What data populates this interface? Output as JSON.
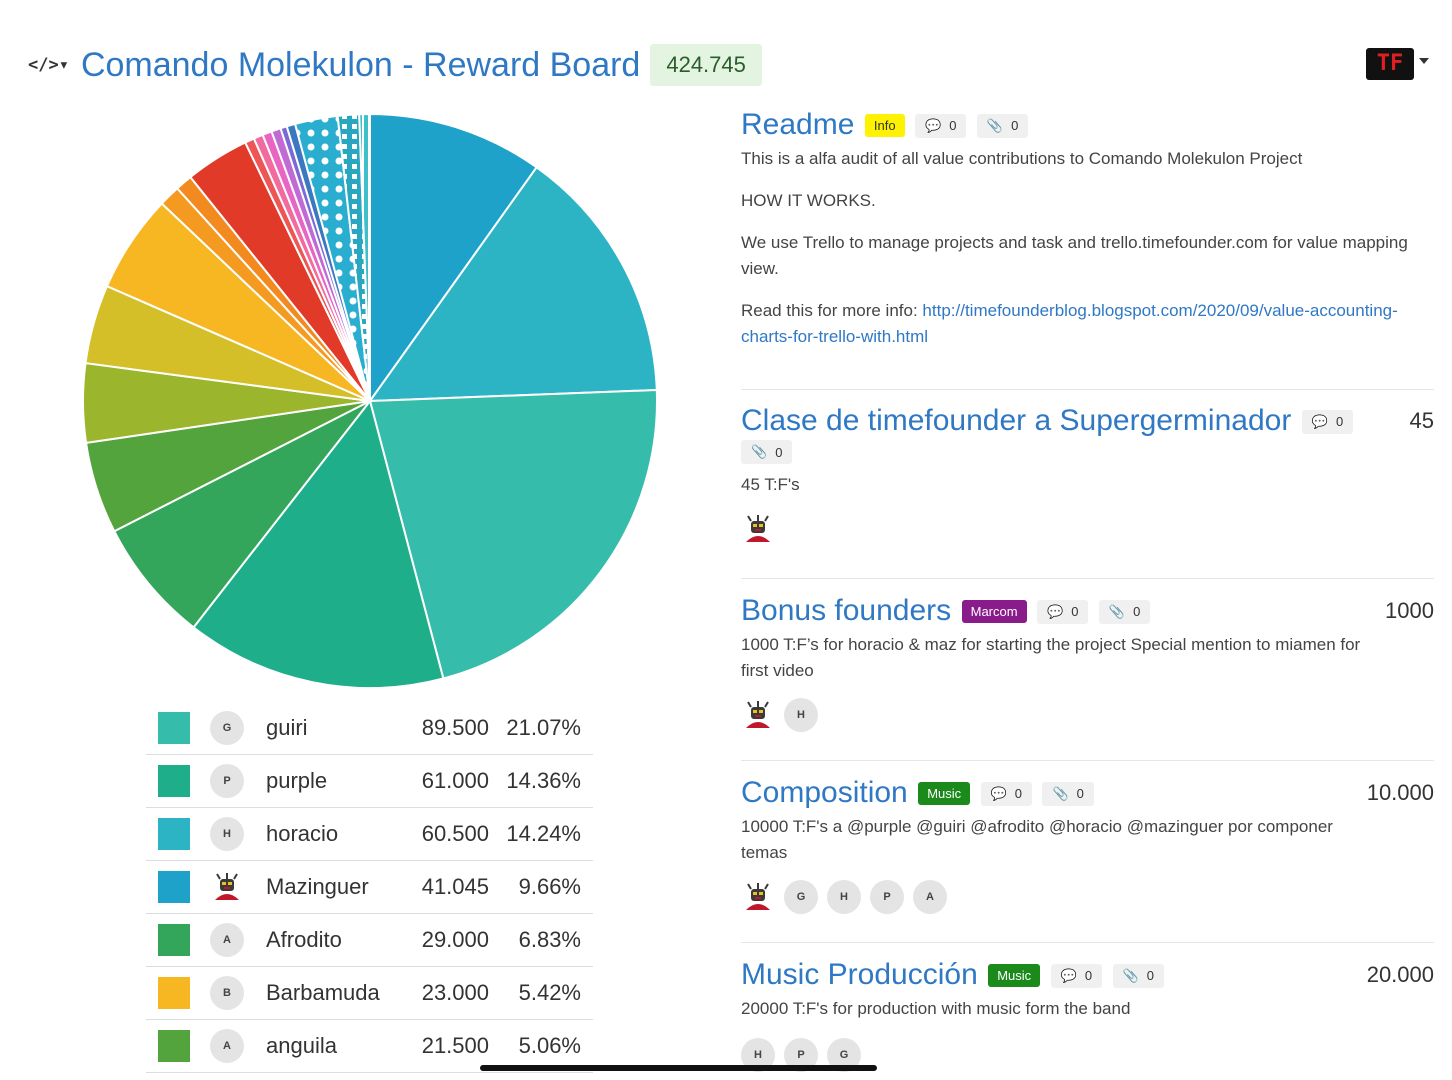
{
  "header": {
    "code_icon": "</>▾",
    "title": "Comando Molekulon - Reward Board",
    "total": "424.745",
    "logo_text": "TF"
  },
  "pie_chart": {
    "slices": [
      {
        "value": 41.045,
        "color": "#1fa2c9"
      },
      {
        "value": 60.5,
        "color": "#2cb4c5"
      },
      {
        "value": 89.5,
        "color": "#36bcab"
      },
      {
        "value": 61.0,
        "color": "#1eaf8a"
      },
      {
        "value": 29.0,
        "color": "#33a65c"
      },
      {
        "value": 21.5,
        "color": "#53a43c"
      },
      {
        "value": 18.5,
        "color": "#9bb62c"
      },
      {
        "value": 18.5,
        "color": "#d5bf29"
      },
      {
        "value": 23.0,
        "color": "#f7b723"
      },
      {
        "value": 5.0,
        "color": "#f59a20"
      },
      {
        "value": 4.0,
        "color": "#f28a1f"
      },
      {
        "value": 15.0,
        "color": "#e13a29"
      },
      {
        "value": 2.2,
        "color": "#ee5555"
      },
      {
        "value": 2.2,
        "color": "#f26b9e"
      },
      {
        "value": 2.2,
        "color": "#e865c4"
      },
      {
        "value": 2.2,
        "color": "#c06ad6"
      },
      {
        "value": 1.5,
        "color": "#7a6ad6"
      },
      {
        "value": 2.0,
        "color": "#3a79c0"
      },
      {
        "value": 10.0,
        "color": "#2aaed0",
        "pattern": "dots"
      },
      {
        "value": 5.0,
        "color": "#2aa7c0",
        "pattern": "squares"
      },
      {
        "value": 2.5,
        "color": "#3fbfc9",
        "pattern": "lines"
      }
    ]
  },
  "legend": [
    {
      "initial": "G",
      "name": "guiri",
      "value": "89.500",
      "pct": "21.07%",
      "color": "#36bcab"
    },
    {
      "initial": "P",
      "name": "purple",
      "value": "61.000",
      "pct": "14.36%",
      "color": "#1eaf8a"
    },
    {
      "initial": "H",
      "name": "horacio",
      "value": "60.500",
      "pct": "14.24%",
      "color": "#2cb4c5"
    },
    {
      "initial": "",
      "name": "Mazinguer",
      "value": "41.045",
      "pct": "9.66%",
      "color": "#1fa2c9"
    },
    {
      "initial": "A",
      "name": "Afrodito",
      "value": "29.000",
      "pct": "6.83%",
      "color": "#33a65c"
    },
    {
      "initial": "B",
      "name": "Barbamuda",
      "value": "23.000",
      "pct": "5.42%",
      "color": "#f7b723"
    },
    {
      "initial": "A",
      "name": "anguila",
      "value": "21.500",
      "pct": "5.06%",
      "color": "#53a43c"
    }
  ],
  "cards": {
    "readme": {
      "title": "Readme",
      "badge": "Info",
      "comments": "0",
      "attachments": "0",
      "line1": "This is a alfa audit of all value contributions to Comando Molekulon Project",
      "line2": "HOW IT WORKS.",
      "line3": "We use Trello to manage projects and task and trello.timefounder.com for value mapping view.",
      "line4_prefix": "Read this for more info: ",
      "line4_link": "http://timefounderblog.blogspot.com/2020/09/value-accounting-charts-for-trello-with.html"
    },
    "clase": {
      "title": "Clase de timefounder a Supergerminador",
      "comments": "0",
      "attachments": "0",
      "points": "45",
      "desc": "45 T:F's"
    },
    "bonus": {
      "title": "Bonus founders",
      "badge": "Marcom",
      "comments": "0",
      "attachments": "0",
      "points": "1000",
      "desc": "1000 T:F’s for horacio & maz for starting the project Special mention to miamen for first video",
      "avatars": [
        "H"
      ]
    },
    "composition": {
      "title": "Composition",
      "badge": "Music",
      "comments": "0",
      "attachments": "0",
      "points": "10.000",
      "desc": "10000 T:F's a @purple @guiri @afrodito @horacio @mazinguer por componer temas",
      "avatars": [
        "G",
        "H",
        "P",
        "A"
      ]
    },
    "music": {
      "title": "Music Producción",
      "badge": "Music",
      "comments": "0",
      "attachments": "0",
      "points": "20.000",
      "desc": "20000 T:F's for production with music form the band",
      "avatars": [
        "H",
        "P",
        "G"
      ]
    }
  },
  "icons": {
    "comment": "comment-icon",
    "attachment": "paperclip-icon",
    "avatar_robot": "robot-avatar-icon"
  }
}
